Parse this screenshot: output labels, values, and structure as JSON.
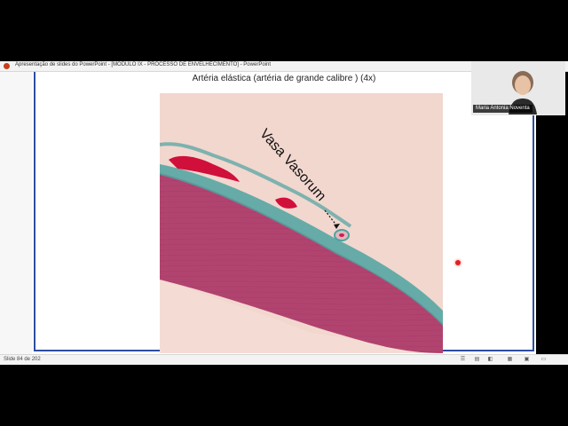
{
  "window": {
    "title": "Apresentação de slides do PowerPoint - [MÓDULO IX - PROCESSO DE ENVELHECIMENTO] - PowerPoint"
  },
  "slide": {
    "title": "Artéria elástica (artéria de grande calibre ) (4x)",
    "annotation": "Vasa Vasorum"
  },
  "status": {
    "slide_counter": "Slide 84 de 202"
  },
  "webcam": {
    "participant_name": "Maria Antonia Noventa"
  },
  "colors": {
    "slide_border": "#2e4e9e",
    "laser_pointer": "#e52020"
  },
  "icons": [
    "powerpoint-icon",
    "notes-icon",
    "normal-view-icon",
    "slide-sorter-icon",
    "reading-view-icon",
    "slideshow-icon"
  ]
}
